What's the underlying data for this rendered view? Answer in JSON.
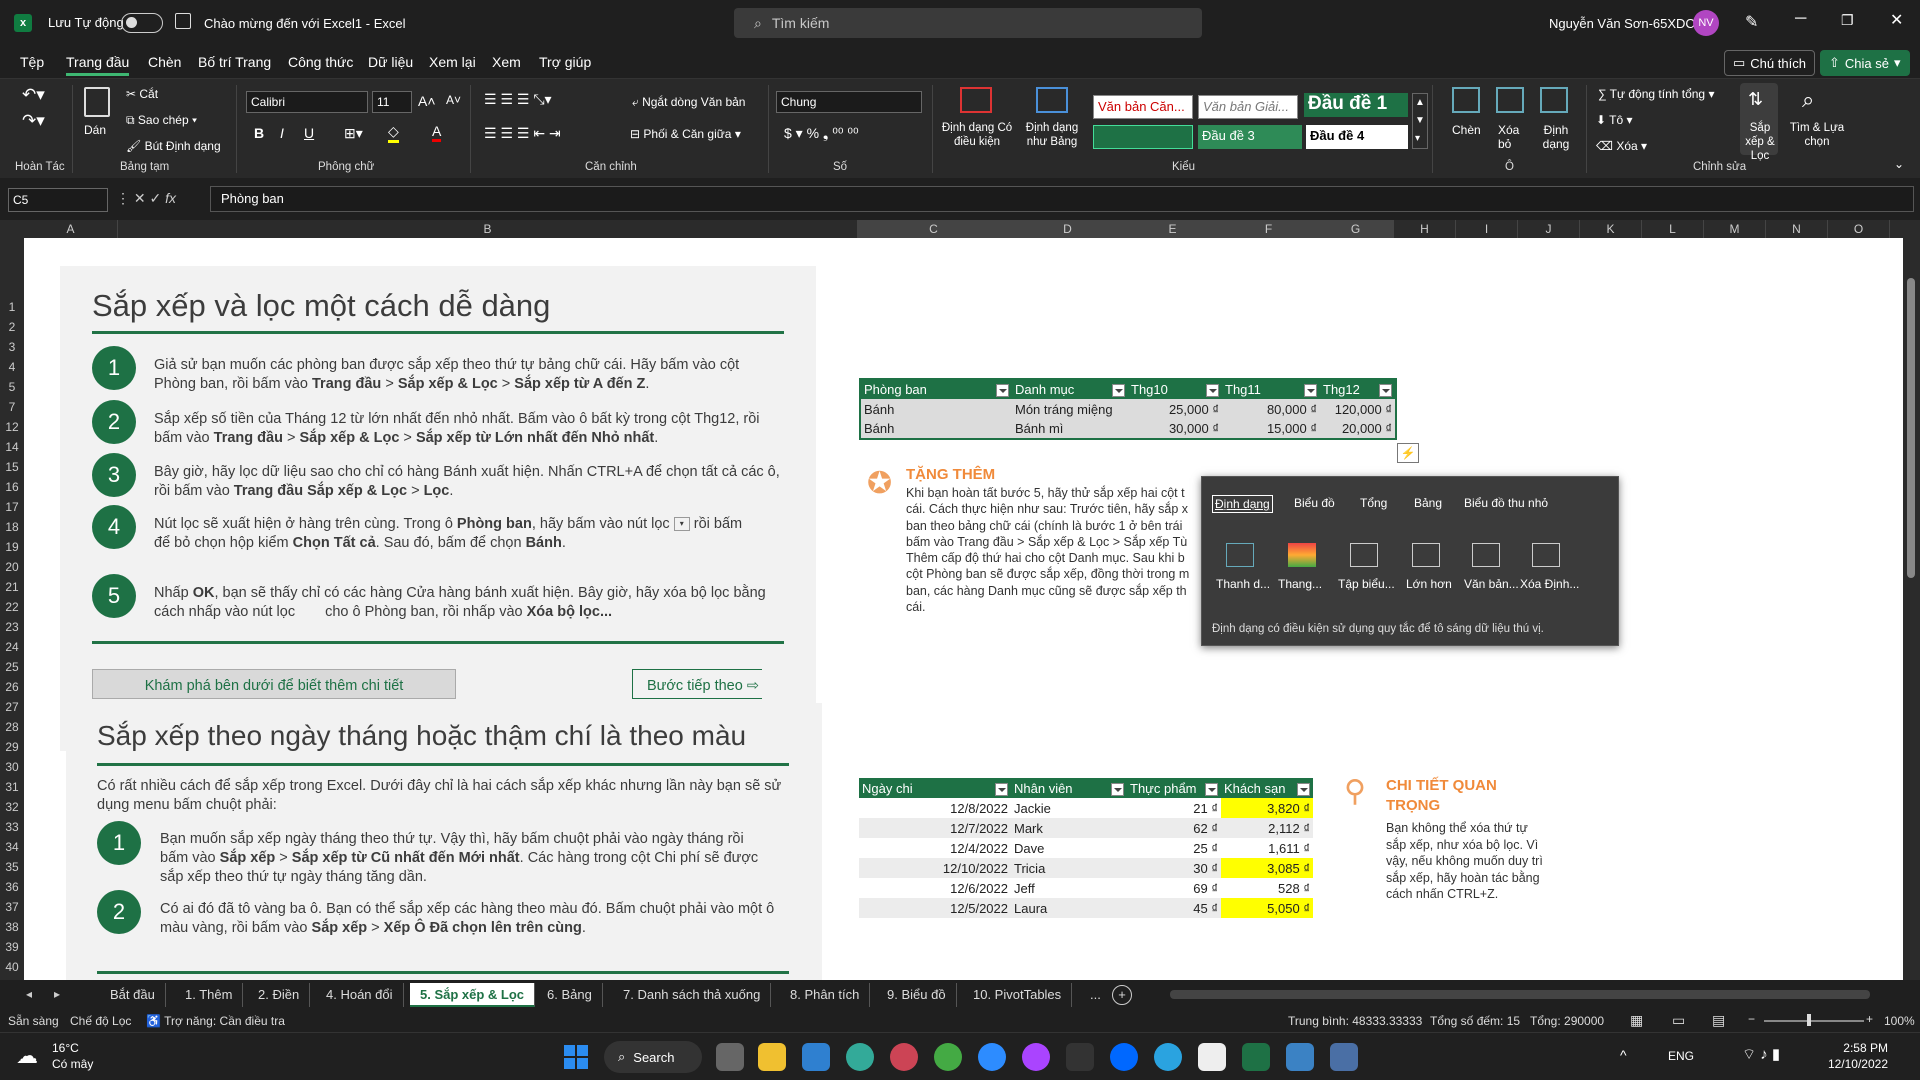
{
  "titlebar": {
    "autosave": "Lưu Tự động",
    "doc_title": "Chào mừng đến với Excel1  -  Excel",
    "search_placeholder": "Tìm kiếm",
    "user": "Nguyễn Văn Sơn-65XDC1",
    "initials": "NV"
  },
  "menu": {
    "items": [
      "Tệp",
      "Trang đầu",
      "Chèn",
      "Bố trí Trang",
      "Công thức",
      "Dữ liệu",
      "Xem lại",
      "Xem",
      "Trợ giúp"
    ],
    "comment": "Chú thích",
    "share": "Chia sẻ"
  },
  "ribbon": {
    "undo_group": "Hoàn Tác",
    "paste": "Dán",
    "cut": "Cắt",
    "copy": "Sao chép",
    "format_painter": "Bút Định dạng",
    "clipboard_group": "Bảng tạm",
    "font_name": "Calibri",
    "font_size": "11",
    "font_group": "Phông chữ",
    "wrap": "Ngắt dòng Văn bản",
    "merge": "Phối & Căn giữa",
    "align_group": "Căn chỉnh",
    "number_format": "Chung",
    "number_group": "Số",
    "cond_format": "Định dạng Có điều kiện",
    "format_table": "Định dạng như Bảng",
    "styles": [
      "Văn bản Căn...",
      "Văn bản Giải...",
      "Đầu đề 1",
      "",
      "Đầu đề 3",
      "Đầu đề 4"
    ],
    "styles_group": "Kiểu",
    "insert": "Chèn",
    "delete": "Xóa bỏ",
    "format": "Định dạng",
    "cells_group": "Ô",
    "autosum": "Tự động tính tổng",
    "fill": "Tô",
    "clear": "Xóa",
    "sort": "Sắp xếp & Lọc",
    "find": "Tìm & Lựa chọn",
    "edit_group": "Chỉnh sửa"
  },
  "formula": {
    "cell_ref": "C5",
    "content": "Phòng ban"
  },
  "columns": [
    "A",
    "B",
    "C",
    "D",
    "E",
    "F",
    "G",
    "H",
    "I",
    "J",
    "K",
    "L",
    "M",
    "N",
    "O"
  ],
  "rows": [
    "1",
    "2",
    "3",
    "4",
    "5",
    "7",
    "12",
    "14",
    "15",
    "16",
    "17",
    "18",
    "19",
    "20",
    "21",
    "22",
    "23",
    "24",
    "25",
    "26",
    "27",
    "28",
    "29",
    "30",
    "31",
    "32",
    "33",
    "34",
    "35",
    "36",
    "37",
    "38",
    "39",
    "40"
  ],
  "section1": {
    "title": "Sắp xếp và lọc một cách dễ dàng",
    "steps": [
      {
        "n": "1",
        "l1": "Giả sử bạn muốn các phòng ban được sắp xếp theo thứ tự bảng chữ cái. Hãy bấm vào cột",
        "l2a": "Phòng ban, rồi bấm vào ",
        "b1": "Trang đầu",
        "s1": " > ",
        "b2": "Sắp xếp & Lọc",
        "s2": " > ",
        "b3": "Sắp xếp từ A đến Z",
        "e": "."
      },
      {
        "n": "2",
        "l1": "Sắp xếp số tiền của Tháng 12 từ lớn nhất đến nhỏ nhất. Bấm vào ô bất kỳ trong cột Thg12, rồi",
        "l2a": "bấm vào ",
        "b1": "Trang đầu",
        "s1": " > ",
        "b2": "Sắp xếp & Lọc",
        "s2": " > ",
        "b3": "Sắp xếp từ Lớn nhất đến Nhỏ nhất",
        "e": "."
      },
      {
        "n": "3",
        "l1": "Bây giờ, hãy lọc dữ liệu sao cho chỉ có hàng Bánh xuất hiện. Nhấn CTRL+A để chọn tất cả các ô,",
        "l2a": "rồi bấm vào ",
        "b1": "Trang đầu",
        "s1": " ",
        "b2": "Sắp xếp & Lọc",
        "s2": " > ",
        "b3": "Lọc",
        "e": "."
      },
      {
        "n": "4",
        "l1a": "Nút lọc sẽ xuất hiện ở hàng trên cùng. Trong ô ",
        "l1b": "Phòng ban",
        "l1c": ", hãy bấm vào nút lọc",
        "l1d": "rồi bấm",
        "l2a": "để bỏ chọn hộp kiểm ",
        "b1": "Chọn Tất cả",
        "s1": ". Sau đó, bấm để chọn ",
        "b2": "Bánh",
        "e": "."
      },
      {
        "n": "5",
        "l1a": "Nhấp ",
        "l1b": "OK",
        "l1c": ", bạn sẽ thấy chỉ có các hàng Cửa hàng bánh xuất hiện. Bây giờ, hãy xóa bộ lọc bằng",
        "l2a": "cách nhấp vào nút lọc",
        "l2b": "cho ô Phòng ban, rồi nhấp vào ",
        "b1": "Xóa bộ lọc...",
        "e": ""
      }
    ],
    "explore": "Khám phá bên dưới để biết thêm chi tiết",
    "next": "Bước tiếp theo"
  },
  "section2": {
    "title": "Sắp xếp theo ngày tháng hoặc thậm chí là theo màu",
    "intro1": "Có rất nhiều cách để sắp xếp trong Excel. Dưới đây chỉ là hai cách sắp xếp khác nhưng lần này bạn sẽ sử",
    "intro2": "dụng menu bấm chuột phải:",
    "steps": [
      {
        "n": "1",
        "l1": "Bạn muốn sắp xếp ngày tháng theo thứ tự. Vậy thì, hãy bấm chuột phải vào ngày tháng rồi",
        "l2a": "bấm vào ",
        "b1": "Sắp xếp",
        "s1": " > ",
        "b2": "Sắp xếp từ Cũ nhất đến Mới nhất",
        "l2c": ". Các hàng trong cột Chi phí sẽ được",
        "l3": "sắp xếp theo thứ tự ngày tháng tăng dần."
      },
      {
        "n": "2",
        "l1": "Có ai đó đã tô vàng ba ô. Bạn có thể sắp xếp các hàng theo màu đó. Bấm chuột phải vào một ô",
        "l2a": "màu vàng, rồi bấm vào ",
        "b1": "Sắp xếp",
        "s1": " > ",
        "b2": "Xếp Ô Đã chọn lên trên cùng",
        "e": "."
      }
    ]
  },
  "table1": {
    "headers": [
      "Phòng ban",
      "Danh mục",
      "Thg10",
      "Thg11",
      "Thg12"
    ],
    "rows": [
      [
        "Bánh",
        "Món tráng miệng",
        "25,000 ₫",
        "80,000 ₫",
        "120,000 ₫"
      ],
      [
        "Bánh",
        "Bánh mì",
        "30,000 ₫",
        "15,000 ₫",
        "20,000 ₫"
      ]
    ]
  },
  "bonus": {
    "title": "TẶNG THÊM",
    "lines": [
      "Khi bạn hoàn tất bước 5, hãy thử sắp xếp hai cột t",
      "cái. Cách thực hiện như sau: Trước tiên, hãy sắp x",
      "ban theo bảng chữ cái (chính là bước 1 ở bên trái",
      "bấm vào Trang đầu > Sắp xếp & Lọc > Sắp xếp Tù",
      "Thêm cấp độ thứ hai cho cột Danh mục. Sau khi b",
      "cột Phòng ban sẽ được sắp xếp, đồng thời trong m",
      "ban, các hàng Danh mục cũng sẽ được sắp xếp th",
      "cái."
    ]
  },
  "quick_analysis": {
    "tabs": [
      "Định dạng",
      "Biểu đồ",
      "Tổng",
      "Bảng",
      "Biểu đồ thu nhỏ"
    ],
    "items": [
      "Thanh d...",
      "Thang...",
      "Tập biểu...",
      "Lớn hơn",
      "Văn bản...",
      "Xóa Định..."
    ],
    "description": "Định dạng có điều kiện sử dụng quy tắc để tô sáng dữ liệu thú vị."
  },
  "table2": {
    "headers": [
      "Ngày chi",
      "Nhân viên",
      "Thực phẩm",
      "Khách sạn"
    ],
    "rows": [
      {
        "d": "12/8/2022",
        "n": "Jackie",
        "f": "21 ₫",
        "h": "3,820 ₫",
        "y": true
      },
      {
        "d": "12/7/2022",
        "n": "Mark",
        "f": "62 ₫",
        "h": "2,112 ₫",
        "y": false
      },
      {
        "d": "12/4/2022",
        "n": "Dave",
        "f": "25 ₫",
        "h": "1,611 ₫",
        "y": false
      },
      {
        "d": "12/10/2022",
        "n": "Tricia",
        "f": "30 ₫",
        "h": "3,085 ₫",
        "y": true
      },
      {
        "d": "12/6/2022",
        "n": "Jeff",
        "f": "69 ₫",
        "h": "528 ₫",
        "y": false
      },
      {
        "d": "12/5/2022",
        "n": "Laura",
        "f": "45 ₫",
        "h": "5,050 ₫",
        "y": true
      }
    ]
  },
  "important": {
    "title1": "CHI TIẾT QUAN",
    "title2": "TRỌNG",
    "lines": [
      "Bạn không thể xóa thứ tự",
      "sắp xếp, như xóa bộ lọc. Vì",
      "vậy, nếu không muốn duy trì",
      "sắp xếp, hãy hoàn tác bằng",
      "cách nhấn CTRL+Z."
    ]
  },
  "tabs": [
    "Bắt đầu",
    "1. Thêm",
    "2. Điền",
    "4. Hoán đổi",
    "5. Sắp xếp & Lọc",
    "6. Bảng",
    "7. Danh sách thả xuống",
    "8. Phân tích",
    "9. Biểu đồ",
    "10. PivotTables",
    "..."
  ],
  "active_tab": 4,
  "status": {
    "ready": "Sẵn sàng",
    "filter_mode": "Chế độ Lọc",
    "accessibility": "Trợ năng: Cần điều tra",
    "average": "Trung bình: 48333.33333",
    "count": "Tổng số đếm: 15",
    "sum": "Tổng: 290000",
    "zoom": "100%"
  },
  "taskbar": {
    "temp": "16°C",
    "weather": "Có mây",
    "search": "Search",
    "lang": "ENG",
    "time": "2:58 PM",
    "date": "12/10/2022"
  }
}
